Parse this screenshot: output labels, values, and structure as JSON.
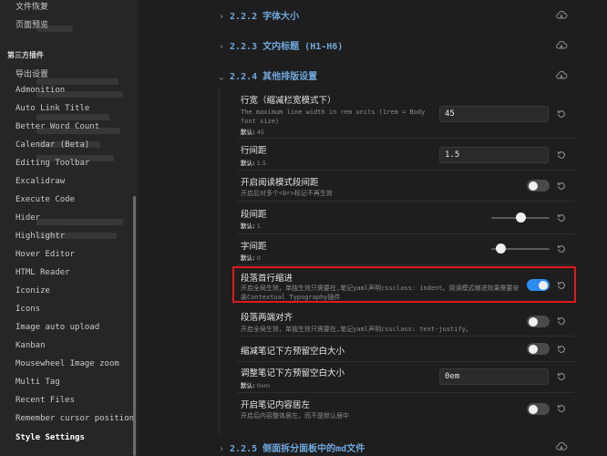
{
  "sidebar": {
    "top_items": [
      "文件恢复",
      "页面预览"
    ],
    "section_label": "第三方插件",
    "items": [
      "导出设置",
      "Admonition",
      "Auto Link Title",
      "Better Word Count",
      "Calendar (Beta)",
      "Editing Toolbar",
      "Excalidraw",
      "Execute Code",
      "Hider",
      "Highlightr",
      "Hover Editor",
      "HTML Reader",
      "Iconize",
      "Icons",
      "Image auto upload",
      "Kanban",
      "Mousewheel Image zoom",
      "Multi Tag",
      "Recent Files",
      "Remember cursor position",
      "Style Settings"
    ],
    "active_item": "Style Settings"
  },
  "main": {
    "sections": [
      {
        "label": "2.2.2 字体大小",
        "chevron": "›"
      },
      {
        "label": "2.2.3 文内标题 (H1-H6)",
        "chevron": "›"
      },
      {
        "label": "2.2.4 其他排版设置",
        "chevron": "⌄"
      },
      {
        "label": "2.2.5 侧面拆分面板中的md文件",
        "chevron": "›"
      }
    ],
    "rows": [
      {
        "title": "行宽（缩减栏宽模式下）",
        "desc": "The maximum line width in rem units (1rem = Body font size)",
        "default_label": "默认:",
        "default_value": "45",
        "control": "input",
        "value": "45"
      },
      {
        "title": "行间距",
        "default_label": "默认:",
        "default_value": "1.5",
        "control": "input",
        "value": "1.5"
      },
      {
        "title": "开启阅读模式段间距",
        "desc": "开启后对多个<br>标记不再生效",
        "control": "toggle",
        "on": false
      },
      {
        "title": "段间距",
        "default_label": "默认:",
        "default_value": "1",
        "control": "slider",
        "level": 0.5
      },
      {
        "title": "字间距",
        "default_label": "默认:",
        "default_value": "0",
        "control": "slider",
        "level": 0.1
      },
      {
        "title": "段落首行缩进",
        "desc": "开启全局生效，单独生效只需要在,笔记yaml声明cssclass: indent。阅读模式缩进效果需要安装Contextual Typography插件",
        "control": "toggle",
        "on": true
      },
      {
        "title": "段落两端对齐",
        "desc": "开启全局生效，单独生效只需要在,笔记yaml声明cssclass: text-justify。",
        "control": "toggle",
        "on": false
      },
      {
        "title": "缩减笔记下方预留空白大小",
        "control": "toggle",
        "on": false
      },
      {
        "title": "调整笔记下方预留空白大小",
        "default_label": "默认:",
        "default_value": "0vm",
        "control": "input",
        "value": "0em"
      },
      {
        "title": "开启笔记内容居左",
        "desc": "开启后内容整体居左，而不是默认居中",
        "control": "toggle",
        "on": false
      }
    ]
  },
  "icons": {
    "section_action": "cloud-reload-icon",
    "row_reset": "reset-icon"
  },
  "colors": {
    "accent": "#2d8cf0",
    "section_head": "#6fa8dc",
    "highlight": "#e01b1b"
  }
}
